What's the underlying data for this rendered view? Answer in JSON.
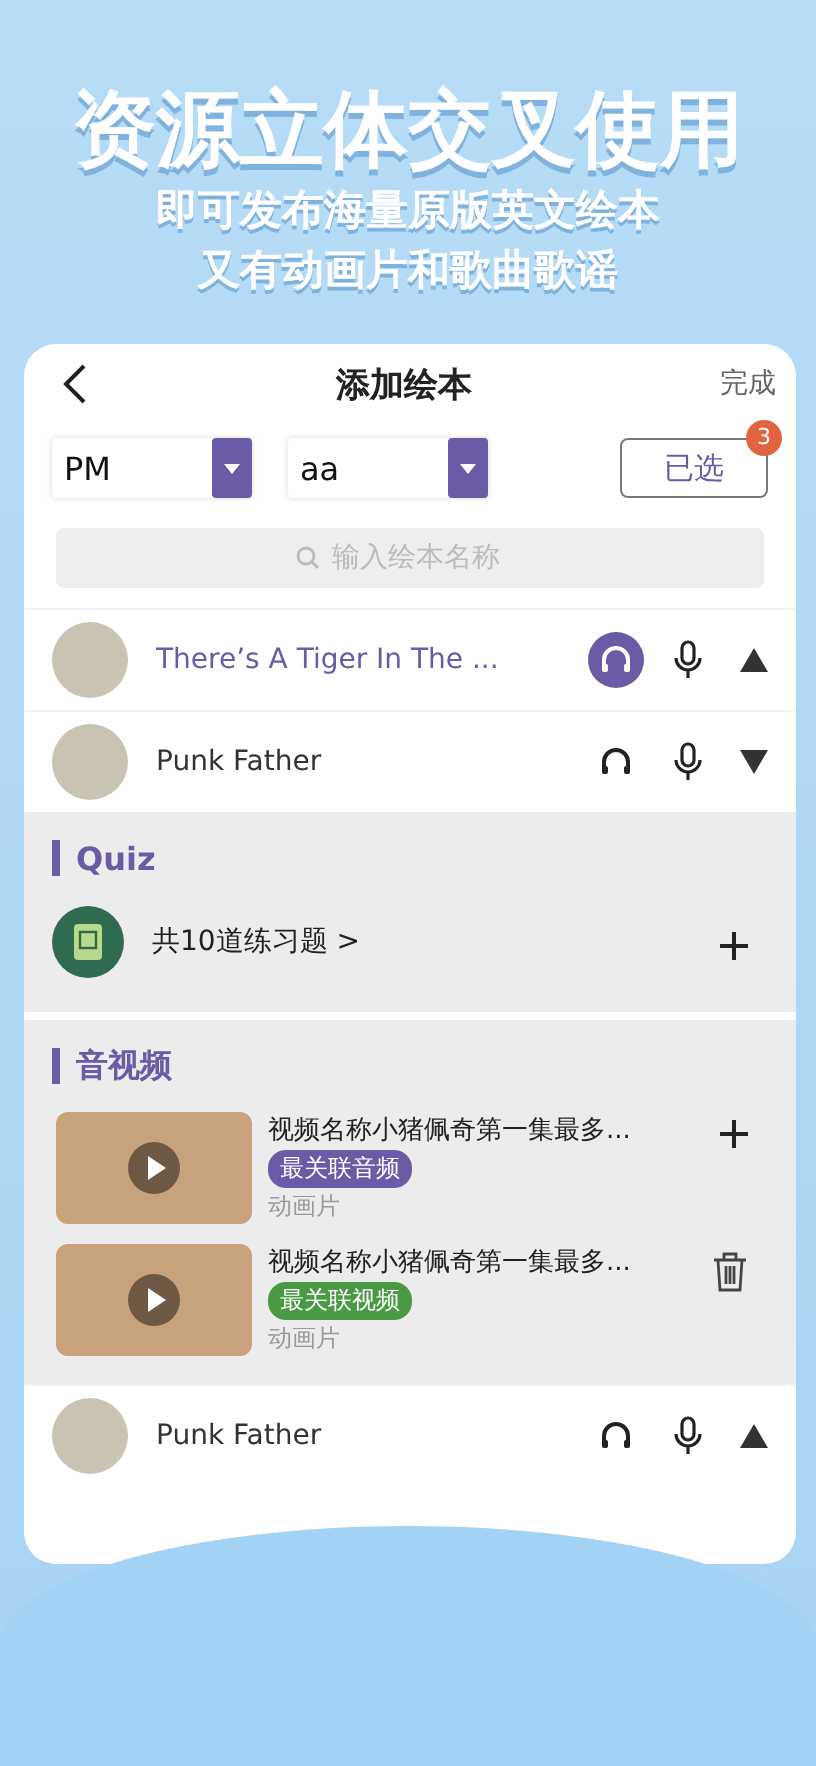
{
  "promo": {
    "headline": "资源立体交叉使用",
    "lines": [
      "即可发布海量原版英文绘本",
      "又有动画片和歌曲歌谣"
    ]
  },
  "nav": {
    "title": "添加绘本",
    "action": "完成"
  },
  "filters": {
    "dropdowns": [
      {
        "value": "PM"
      },
      {
        "value": "aa"
      }
    ],
    "selected_button": {
      "label": "已选",
      "badge": "3"
    }
  },
  "search": {
    "placeholder": "输入绘本名称"
  },
  "books": [
    {
      "title": "There’s A Tiger In The ...",
      "selected": true,
      "expanded": true
    },
    {
      "title": "Punk Father",
      "selected": false,
      "expanded": false
    }
  ],
  "quiz": {
    "heading": "Quiz",
    "item": "共10道练习题 >"
  },
  "media": {
    "heading": "音视频",
    "items": [
      {
        "title": "视频名称小猪佩奇第一集最多...",
        "tag": "最关联音频",
        "color": "#6b5aa6",
        "type": "动画片",
        "kind": "add"
      },
      {
        "title": "视频名称小猪佩奇第一集最多...",
        "tag": "最关联视频",
        "color": "#4a9a45",
        "type": "动画片",
        "kind": "delete"
      }
    ]
  },
  "more_books": [
    {
      "title": "Punk Father",
      "selected": false,
      "expanded": true
    }
  ]
}
